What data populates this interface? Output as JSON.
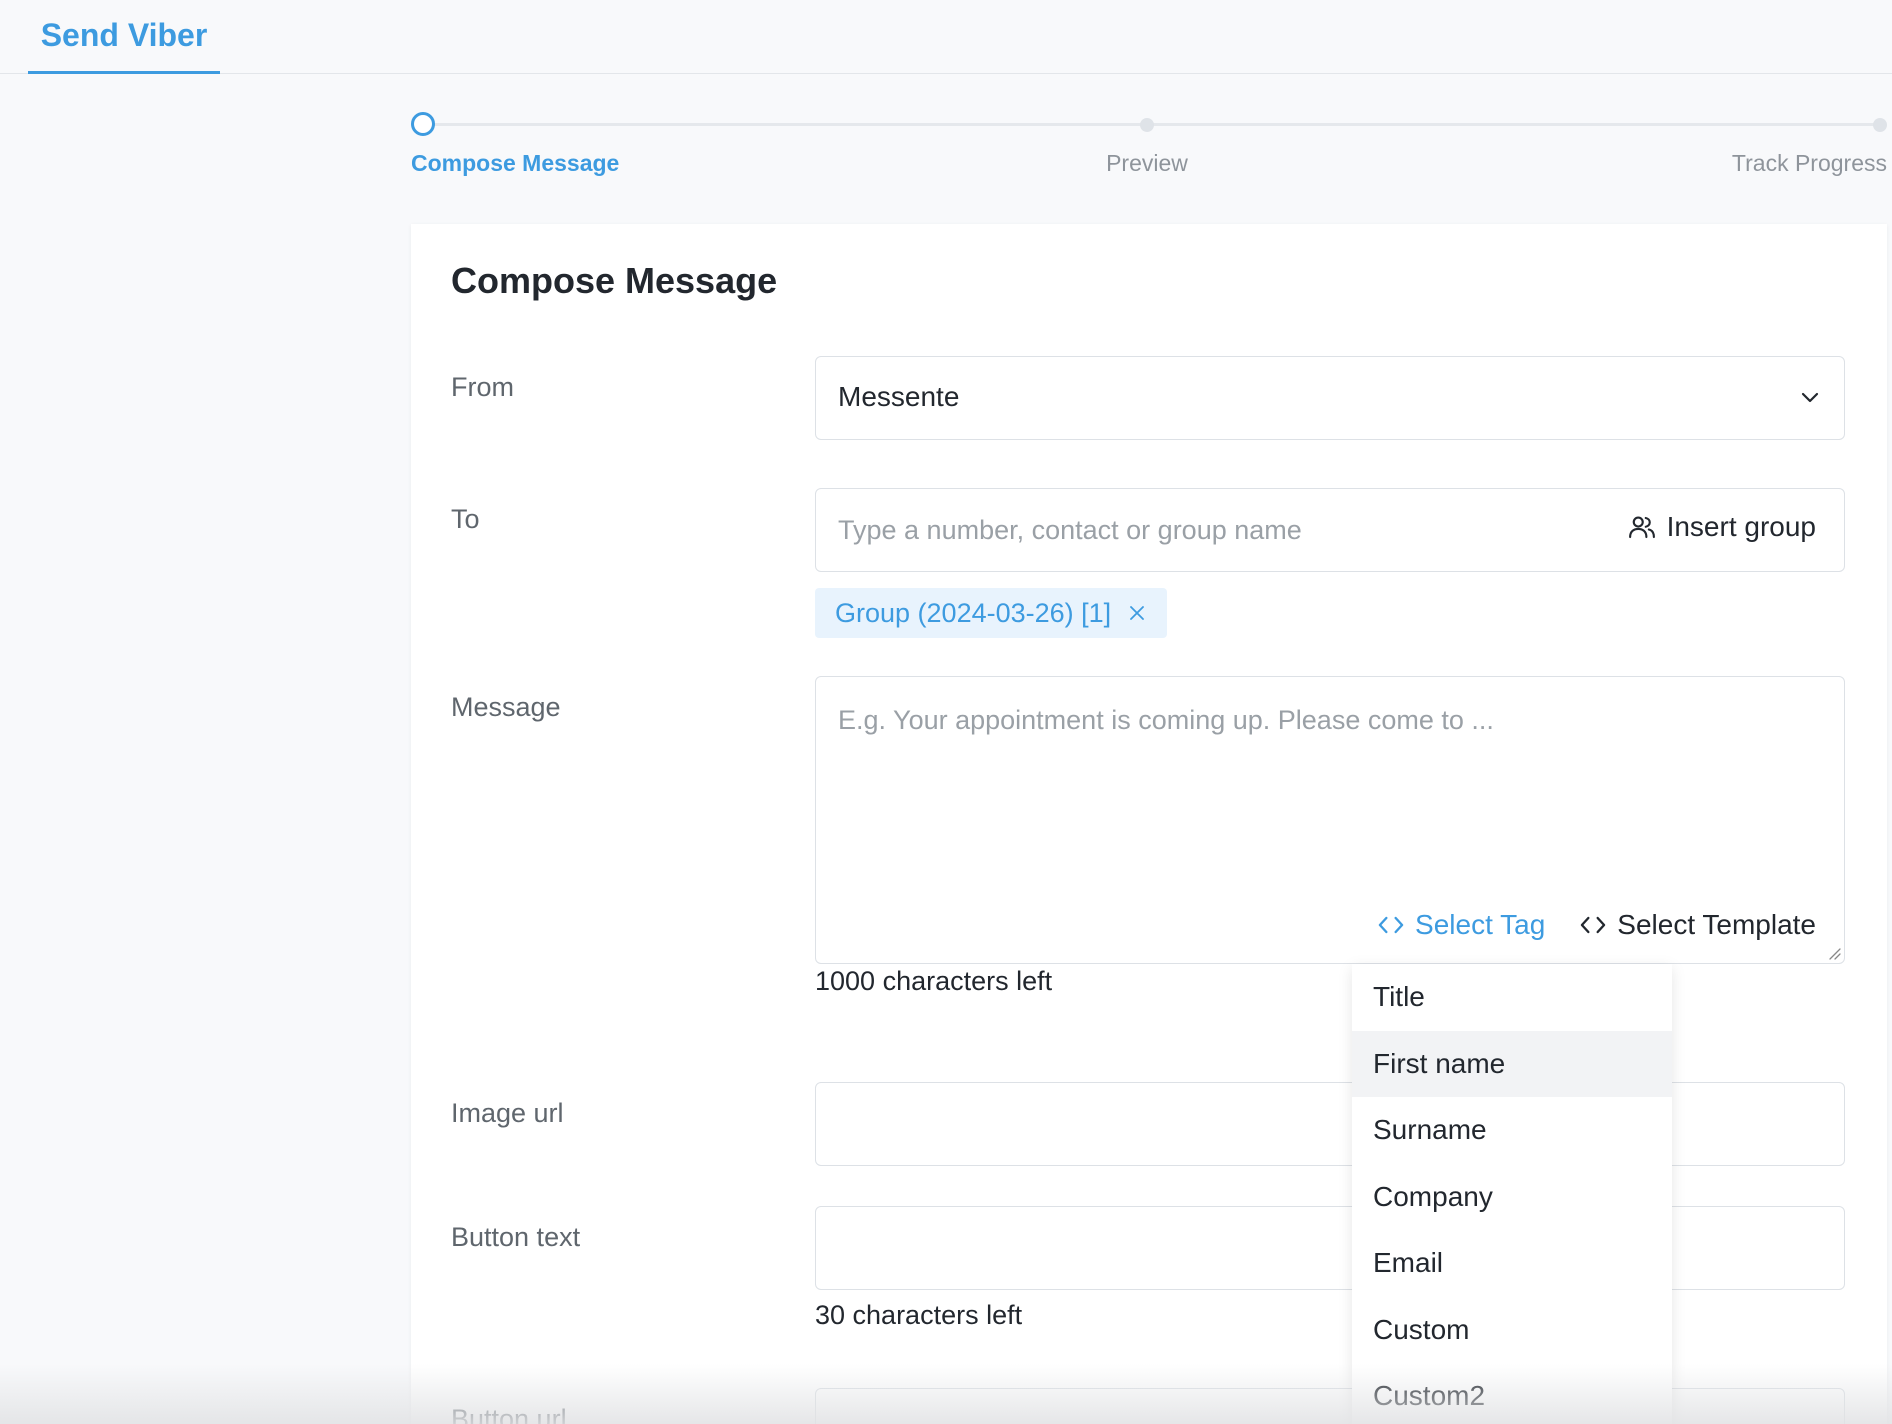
{
  "header": {
    "tab_label": "Send Viber"
  },
  "stepper": {
    "steps": [
      {
        "label": "Compose Message",
        "active": true
      },
      {
        "label": "Preview",
        "active": false
      },
      {
        "label": "Track Progress",
        "active": false
      }
    ]
  },
  "form": {
    "title": "Compose Message",
    "from": {
      "label": "From",
      "value": "Messente"
    },
    "to": {
      "label": "To",
      "placeholder": "Type a number, contact or group name",
      "insert_group_label": "Insert group",
      "chips": [
        "Group (2024-03-26) [1]"
      ]
    },
    "message": {
      "label": "Message",
      "placeholder": "E.g. Your appointment is coming up. Please come to ...",
      "select_tag_label": "Select Tag",
      "select_template_label": "Select Template",
      "counter": "1000 characters left"
    },
    "image_url": {
      "label": "Image url",
      "value": ""
    },
    "button_text": {
      "label": "Button text",
      "value": "",
      "counter": "30 characters left"
    },
    "button_url": {
      "label": "Button url"
    }
  },
  "tag_dropdown": {
    "items": [
      "Title",
      "First name",
      "Surname",
      "Company",
      "Email",
      "Custom",
      "Custom2"
    ],
    "highlighted": "First name"
  },
  "colors": {
    "accent": "#3d9be0",
    "chip_bg": "#e8f3fd",
    "text": "#22272e",
    "muted": "#5f666d"
  }
}
